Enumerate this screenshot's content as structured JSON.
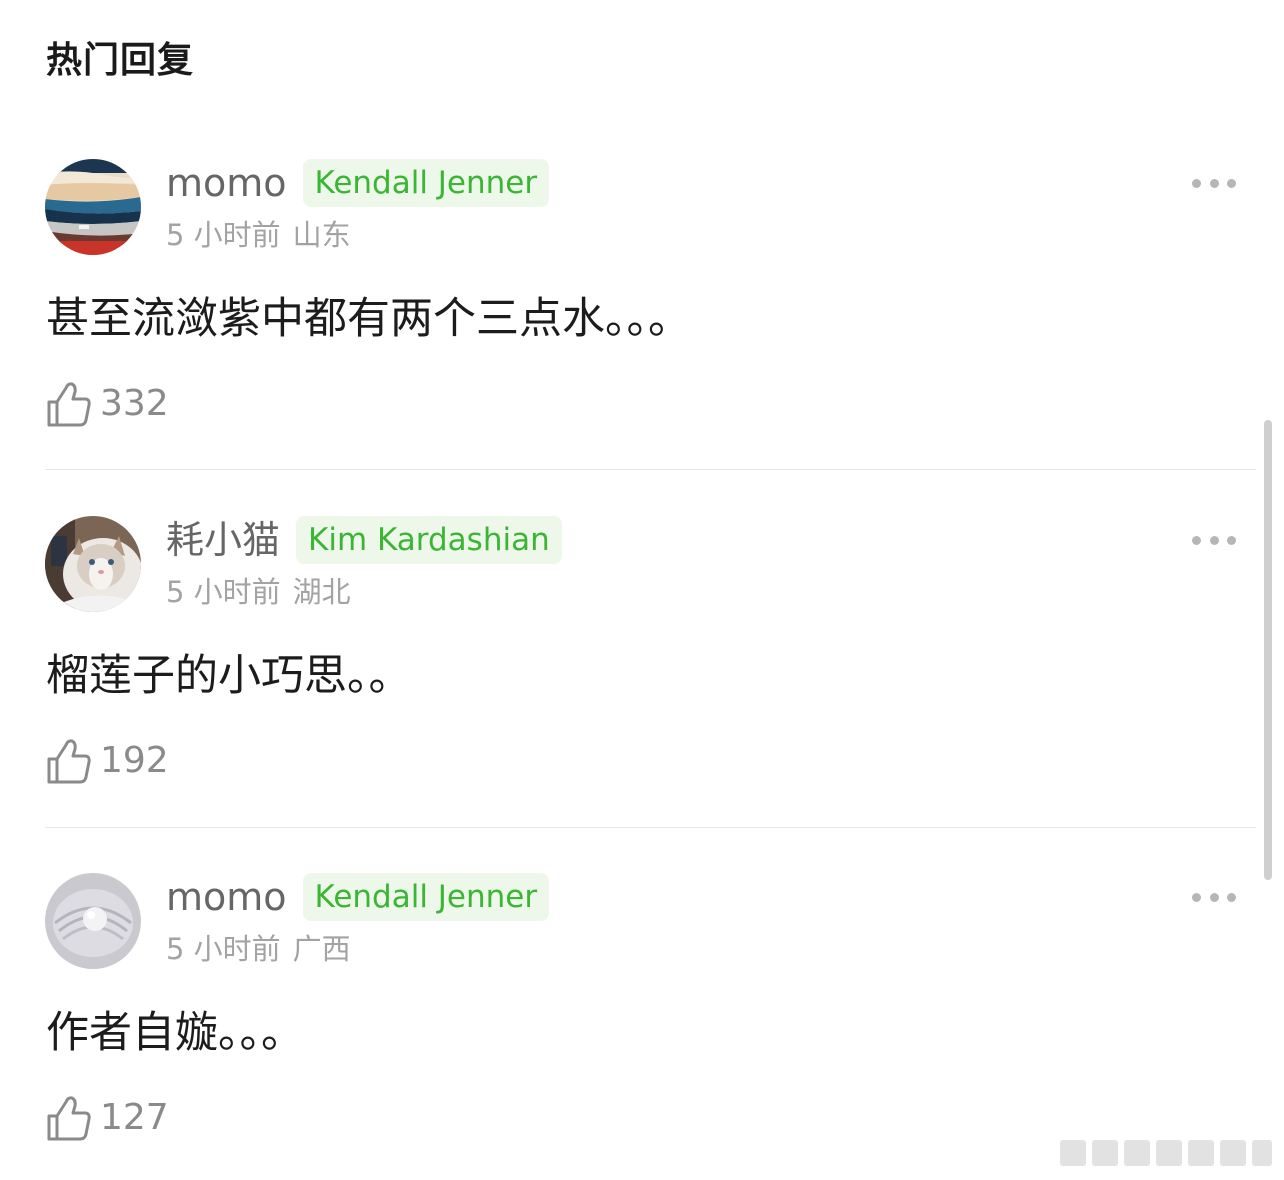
{
  "section": {
    "title": "热门回复"
  },
  "comments": [
    {
      "username": "momo",
      "badge": "Kendall Jenner",
      "time": "5 小时前",
      "location": "山东",
      "text": "甚至流潋紫中都有两个三点水。。。",
      "likes": "332",
      "avatar_icon": "landscape-photo-avatar"
    },
    {
      "username": "耗小猫",
      "badge": "Kim Kardashian",
      "time": "5 小时前",
      "location": "湖北",
      "text": "榴莲子的小巧思。。",
      "likes": "192",
      "avatar_icon": "cat-photo-avatar"
    },
    {
      "username": "momo",
      "badge": "Kendall Jenner",
      "time": "5 小时前",
      "location": "广西",
      "text": "作者自嫙。。。",
      "likes": "127",
      "avatar_icon": "pearl-shell-avatar"
    }
  ],
  "colors": {
    "badge_text": "#3bb534",
    "badge_bg": "#eef8ea",
    "meta_text": "#a3a3a3"
  }
}
